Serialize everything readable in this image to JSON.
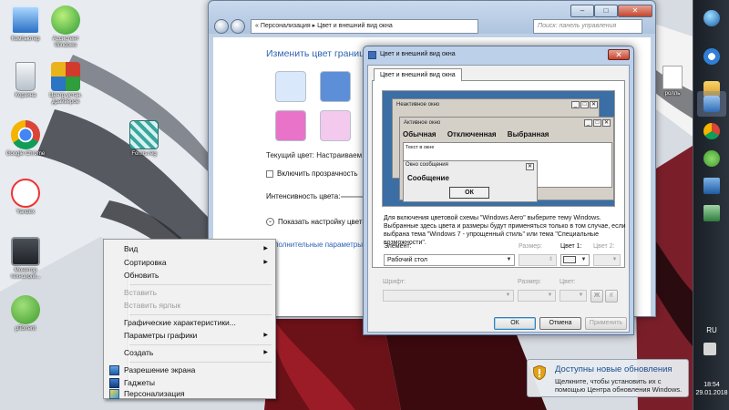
{
  "desktop": {
    "icons": [
      {
        "label": "Компьютер"
      },
      {
        "label": "Ассистент Windows"
      },
      {
        "label": "Корзина"
      },
      {
        "label": "Центр устан. драйверов"
      },
      {
        "label": "Google Chrome"
      },
      {
        "label": "Forms.reg"
      },
      {
        "label": "Yandex"
      },
      {
        "label": "Монитор технологи..."
      },
      {
        "label": "µTorrent"
      }
    ],
    "partial_label": "ролль"
  },
  "personalization_window": {
    "address": {
      "prefix": "«",
      "segments": [
        "Персонализация",
        "Цвет и внешний вид окна"
      ]
    },
    "search_placeholder": "Поиск: панель управления",
    "heading": "Изменить цвет границ ок",
    "current_color": "Текущий цвет: Настраиваем",
    "transparency_label": "Включить прозрачность",
    "intensity_label": "Интенсивность цвета:",
    "mixer_label": "Показать настройку цветов",
    "advanced_link": "дополнительные параметры о",
    "swatch_colors": [
      "#d9e8fb",
      "#5c8fd8",
      "#a9d4ee",
      "#e873c8",
      "#f4c9ee",
      "#f1d9f1"
    ],
    "controls": {
      "minimize": "–",
      "maximize": "□",
      "close": "✕"
    }
  },
  "appearance_dialog": {
    "title": "Цвет и внешний вид окна",
    "tab": "Цвет и внешний вид окна",
    "preview": {
      "inactive_title": "Неактивное окно",
      "active_title": "Активное окно",
      "menu": [
        "Обычная",
        "Отключенная",
        "Выбранная"
      ],
      "window_text": "Текст в окне",
      "message_title": "Окно сообщения",
      "message_text": "Сообщение",
      "ok": "ОК"
    },
    "info": "Для включения цветовой схемы \"Windows Aero\" выберите тему Windows. Выбранные здесь цвета и размеры будут применяться только в том случае, если выбрана тема \"Windows 7 - упрощенный стиль\" или тема \"Специальные возможности\".",
    "element_label": "Элемент:",
    "element_value": "Рабочий стол",
    "size_label": "Размер:",
    "color1_label": "Цвет 1:",
    "color2_label": "Цвет 2:",
    "font_label": "Шрифт:",
    "font_size_label": "Размер:",
    "font_color_label": "Цвет:",
    "bold_label": "Ж",
    "italic_label": "К",
    "color1_value": "#f4f4f4",
    "buttons": {
      "ok": "ОК",
      "cancel": "Отмена",
      "apply": "Применить"
    },
    "close_label": "✕"
  },
  "context_menu": {
    "items": [
      {
        "label": "Вид",
        "submenu": true,
        "disabled": false
      },
      {
        "label": "Сортировка",
        "submenu": true,
        "disabled": false
      },
      {
        "label": "Обновить",
        "submenu": false,
        "disabled": false
      },
      {
        "label": "Вставить",
        "submenu": false,
        "disabled": true
      },
      {
        "label": "Вставить ярлык",
        "submenu": false,
        "disabled": true
      },
      {
        "label": "Графические характеристики...",
        "submenu": false,
        "disabled": false
      },
      {
        "label": "Параметры графики",
        "submenu": true,
        "disabled": false
      },
      {
        "label": "Создать",
        "submenu": true,
        "disabled": false
      },
      {
        "label": "Разрешение экрана",
        "submenu": false,
        "disabled": false,
        "icon": "screen-resolution-icon"
      },
      {
        "label": "Гаджеты",
        "submenu": false,
        "disabled": false,
        "icon": "gadgets-icon"
      },
      {
        "label": "Персонализация",
        "submenu": false,
        "disabled": false,
        "icon": "personalization-icon"
      }
    ],
    "submenu_arrow": "▶"
  },
  "notification": {
    "title": "Доступны новые обновления",
    "text": "Щелкните, чтобы установить их с помощью Центра обновления Windows."
  },
  "taskbar": {
    "language": "RU",
    "time": "18:54",
    "date": "29.01.2018"
  },
  "colors": {
    "accent_link": "#2c63b3",
    "taskbar": "#1f242b",
    "notif_title": "#1b4e8f"
  }
}
